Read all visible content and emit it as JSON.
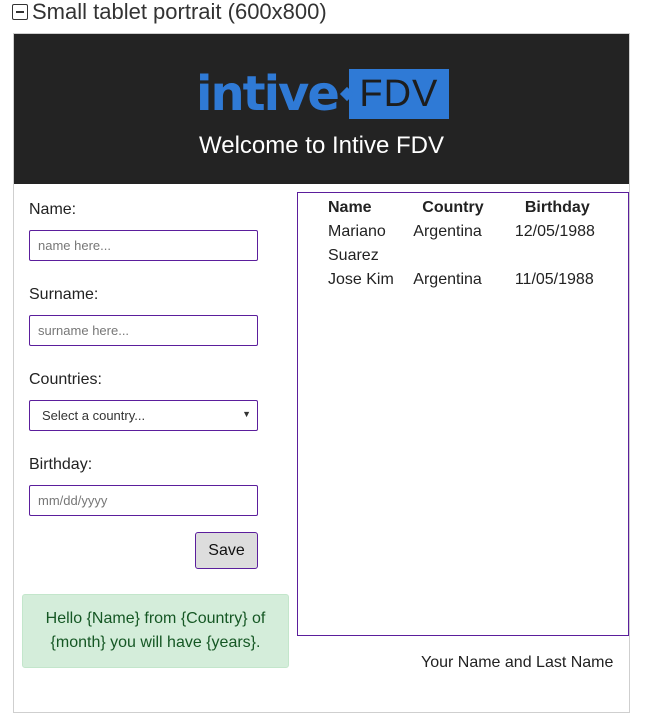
{
  "section": {
    "title": "Small tablet portrait (600x800)",
    "toggle_icon": "collapse-icon"
  },
  "header": {
    "logo_word": "intive",
    "logo_box_text": "FDV",
    "welcome": "Welcome to Intive FDV",
    "background": "#232323",
    "brand_color": "#2f7ad6"
  },
  "form": {
    "name_label": "Name:",
    "name_placeholder": "name here...",
    "surname_label": "Surname:",
    "surname_placeholder": "surname here...",
    "countries_label": "Countries:",
    "country_select_value": "Select a country...",
    "birthday_label": "Birthday:",
    "birthday_placeholder": "mm/dd/yyyy",
    "save_label": "Save",
    "accent_color": "#5b1e9c"
  },
  "message": {
    "text": "Hello {Name} from {Country} of {month} you will have {years}."
  },
  "table": {
    "headers": [
      "Name",
      "Country",
      "Birthday"
    ],
    "rows": [
      [
        "Mariano Suarez",
        "Argentina",
        "12/05/1988"
      ],
      [
        "Jose Kim",
        "Argentina",
        "11/05/1988"
      ]
    ]
  },
  "footer": {
    "name": "Your Name and Last Name"
  }
}
